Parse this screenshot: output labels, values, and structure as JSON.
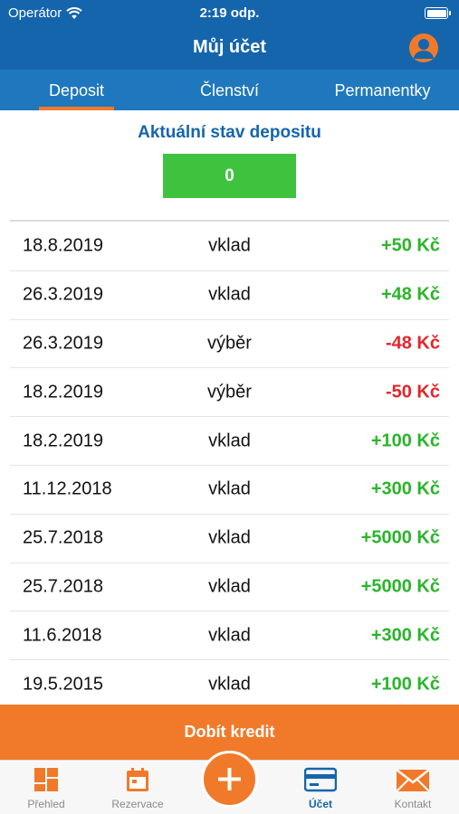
{
  "status": {
    "carrier": "Operátor",
    "time": "2:19 odp."
  },
  "header": {
    "title": "Můj účet"
  },
  "tabs": [
    {
      "label": "Deposit",
      "active": true
    },
    {
      "label": "Členství",
      "active": false
    },
    {
      "label": "Permanentky",
      "active": false
    }
  ],
  "deposit": {
    "title": "Aktuální stav depositu",
    "balance": "0"
  },
  "transactions": [
    {
      "date": "18.8.2019",
      "type": "vklad",
      "amount": "+50 Kč",
      "sign": "pos"
    },
    {
      "date": "26.3.2019",
      "type": "vklad",
      "amount": "+48 Kč",
      "sign": "pos"
    },
    {
      "date": "26.3.2019",
      "type": "výběr",
      "amount": "-48 Kč",
      "sign": "neg"
    },
    {
      "date": "18.2.2019",
      "type": "výběr",
      "amount": "-50 Kč",
      "sign": "neg"
    },
    {
      "date": "18.2.2019",
      "type": "vklad",
      "amount": "+100 Kč",
      "sign": "pos"
    },
    {
      "date": "11.12.2018",
      "type": "vklad",
      "amount": "+300 Kč",
      "sign": "pos"
    },
    {
      "date": "25.7.2018",
      "type": "vklad",
      "amount": "+5000 Kč",
      "sign": "pos"
    },
    {
      "date": "25.7.2018",
      "type": "vklad",
      "amount": "+5000 Kč",
      "sign": "pos"
    },
    {
      "date": "11.6.2018",
      "type": "vklad",
      "amount": "+300 Kč",
      "sign": "pos"
    },
    {
      "date": "19.5.2015",
      "type": "vklad",
      "amount": "+100 Kč",
      "sign": "pos"
    }
  ],
  "actions": {
    "topup_label": "Dobít kredit"
  },
  "tabbar": {
    "items": [
      {
        "label": "Přehled",
        "icon": "dashboard-icon"
      },
      {
        "label": "Rezervace",
        "icon": "calendar-icon"
      },
      {
        "label": "Účet",
        "icon": "card-icon",
        "active": true
      },
      {
        "label": "Kontakt",
        "icon": "mail-icon"
      }
    ],
    "fab_icon": "plus-icon"
  },
  "colors": {
    "primary": "#1565ad",
    "accent": "#f07a2a",
    "positive": "#2ab52a",
    "negative": "#e5262b",
    "balance": "#3fc33f"
  }
}
